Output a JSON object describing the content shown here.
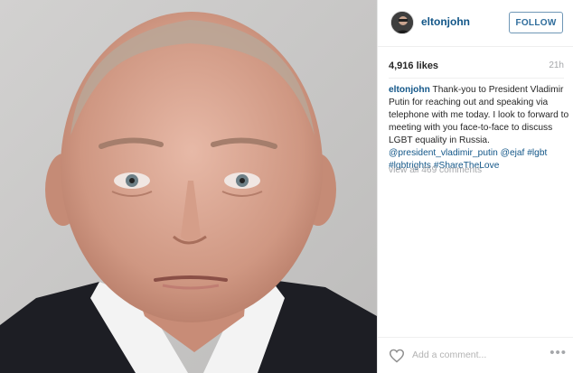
{
  "post": {
    "username": "eltonjohn",
    "follow_label": "FOLLOW",
    "likes": "4,916 likes",
    "time": "21h",
    "caption": {
      "username": "eltonjohn",
      "text": "Thank-you to President Vladimir Putin for reaching out and speaking via telephone with me today. I look to forward to meeting with you face-to-face to discuss LGBT equality in Russia.",
      "tags": [
        "@president_vladimir_putin",
        "@ejaf",
        "#lgbt",
        "#lgbtrights",
        "#ShareTheLove"
      ]
    },
    "view_all_comments": "view all 469 comments",
    "comment_placeholder": "Add a comment...",
    "more_label": "•••"
  },
  "icons": {
    "like": "heart-icon",
    "more": "more-options-icon"
  },
  "colors": {
    "link": "#125688",
    "muted": "#a5a7aa",
    "photo_bg": "#c9c8c6"
  }
}
